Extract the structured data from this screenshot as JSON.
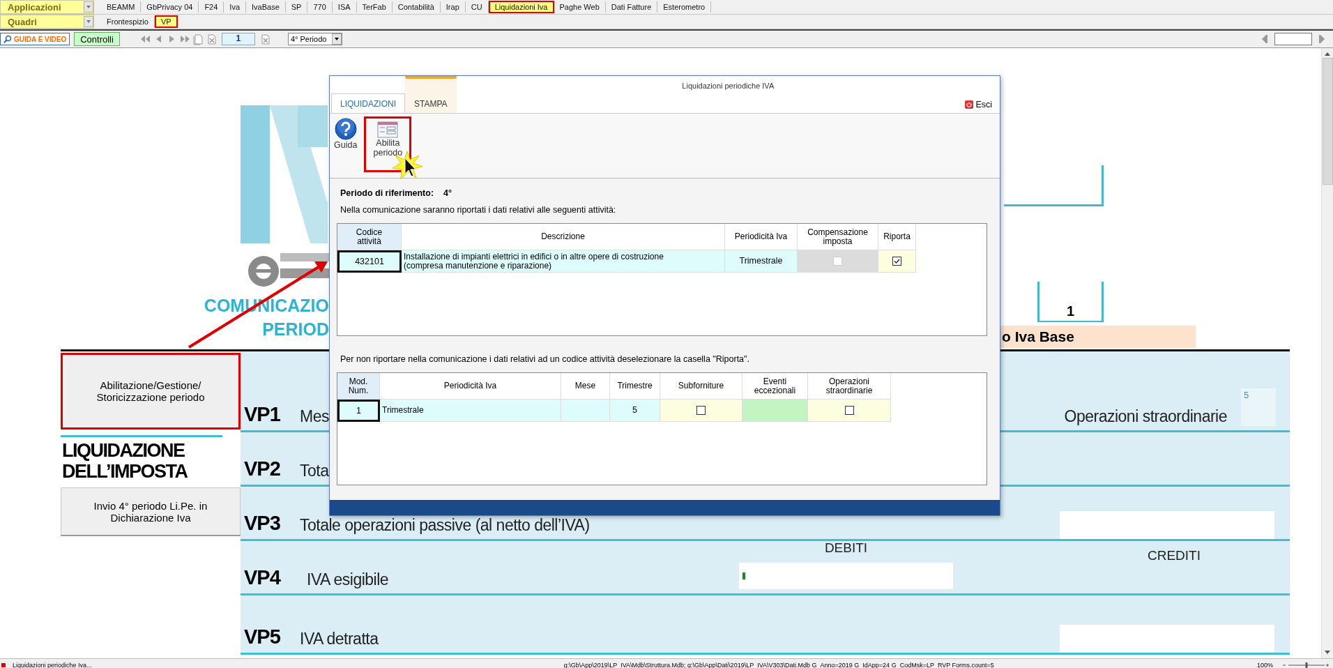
{
  "menu_bar": {
    "dropdown": "Applicazioni",
    "items": [
      {
        "label": "BEAMM",
        "selected": false
      },
      {
        "label": "GbPrivacy 04",
        "selected": false
      },
      {
        "label": "F24",
        "selected": false
      },
      {
        "label": "Iva",
        "selected": false
      },
      {
        "label": "IvaBase",
        "selected": false
      },
      {
        "label": "SP",
        "selected": false
      },
      {
        "label": "770",
        "selected": false
      },
      {
        "label": "ISA",
        "selected": false
      },
      {
        "label": "TerFab",
        "selected": false
      },
      {
        "label": "Contabilità",
        "selected": false
      },
      {
        "label": "Irap",
        "selected": false
      },
      {
        "label": "CU",
        "selected": false
      },
      {
        "label": "Liquidazioni Iva",
        "selected": true
      },
      {
        "label": "Paghe Web",
        "selected": false
      },
      {
        "label": "Dati Fatture",
        "selected": false
      },
      {
        "label": "Esterometro",
        "selected": false
      }
    ]
  },
  "section_bar": {
    "dropdown": "Quadri",
    "items": [
      {
        "label": "Frontespizio",
        "selected": false
      },
      {
        "label": "VP",
        "selected": true
      }
    ]
  },
  "toolbar": {
    "guide_button": "GUIDA E VIDEO",
    "controls_button": "Controlli",
    "page_field": "1",
    "period_dropdown": "4° Periodo"
  },
  "form": {
    "heading_lines": [
      "COMUNICAZIO",
      "PERIOD"
    ],
    "number_box": "1",
    "band": "o Iva Base",
    "side_buttons": [
      {
        "label": "Abilitazione/Gestione/ Storicizzazione periodo",
        "highlighted": true
      },
      {
        "label": "Invio 4° periodo Li.Pe. in Dichiarazione Iva",
        "highlighted": false
      }
    ],
    "section_title": "LIQUIDAZIONE DELL’IMPOSTA",
    "rows": [
      {
        "code": "VP1",
        "label": "Mes",
        "kind": "extraordinary"
      },
      {
        "code": "VP2",
        "label": "Tota",
        "kind": "plain"
      },
      {
        "code": "VP3",
        "label": "Totale operazioni passive (al netto dell’IVA)",
        "kind": "credit_field"
      },
      {
        "code": "VP4",
        "label": "IVA esigibile",
        "kind": "debit_field"
      },
      {
        "code": "VP5",
        "label": "IVA detratta",
        "kind": "credit_field"
      }
    ],
    "extraordinary_label": "Operazioni straordinarie",
    "extraordinary_box": "5",
    "debit_header": "DEBITI",
    "credit_header": "CREDITI"
  },
  "dialog": {
    "title": "Liquidazioni periodiche IVA",
    "tabs": [
      {
        "label": "LIQUIDAZIONI",
        "selected": true
      },
      {
        "label": "STAMPA",
        "selected": false
      }
    ],
    "exit": "Esci",
    "ribbon": [
      {
        "label": "Guida",
        "kind": "help",
        "highlighted": false
      },
      {
        "label": "Abilita periodo",
        "kind": "form",
        "highlighted": true
      }
    ],
    "period_label": "Periodo di riferimento:",
    "period_value": "4°",
    "intro": "Nella comunicazione saranno riportati i dati relativi alle seguenti attività:",
    "activities": {
      "columns": [
        "Codice attività",
        "Descrizione",
        "Periodicità Iva",
        "Compensazione imposta",
        "Riporta"
      ],
      "rows": [
        {
          "code": "432101",
          "description": "Installazione di impianti elettrici in edifici o in altre opere di costruzione (compresa manutenzione e riparazione)",
          "periodicity": "Trimestrale",
          "compensation": {
            "checked": false,
            "disabled": true
          },
          "report": {
            "checked": true,
            "disabled": false
          }
        }
      ]
    },
    "note": "Per non riportare nella comunicazione i dati relativi ad un codice attività deselezionare la casella \"Riporta\".",
    "modules": {
      "columns": [
        "Mod. Num.",
        "Periodicità Iva",
        "Mese",
        "Trimestre",
        "Subforniture",
        "Eventi eccezionali",
        "Operazioni straordinarie"
      ],
      "rows": [
        {
          "number": "1",
          "periodicity": "Trimestrale",
          "quarter": "5",
          "subcontracting": {
            "checked": false
          },
          "extraordinary": {
            "checked": false
          }
        }
      ]
    }
  },
  "status_bar": {
    "task": "Liquidazioni periodiche Iva...",
    "path": "g:\\Gb\\App\\2019\\LP_IVA\\Mdb\\Struttura.Mdb; g:\\Gb\\App\\Dati\\2019\\LP_IVA\\V303\\Dati.Mdb G_Anno=2019 G_IdApp=24 G_CodMsk=LP_RVP Forms.count=5",
    "zoom": "100%",
    "zoom_slider": {
      "level": 0.5
    }
  }
}
